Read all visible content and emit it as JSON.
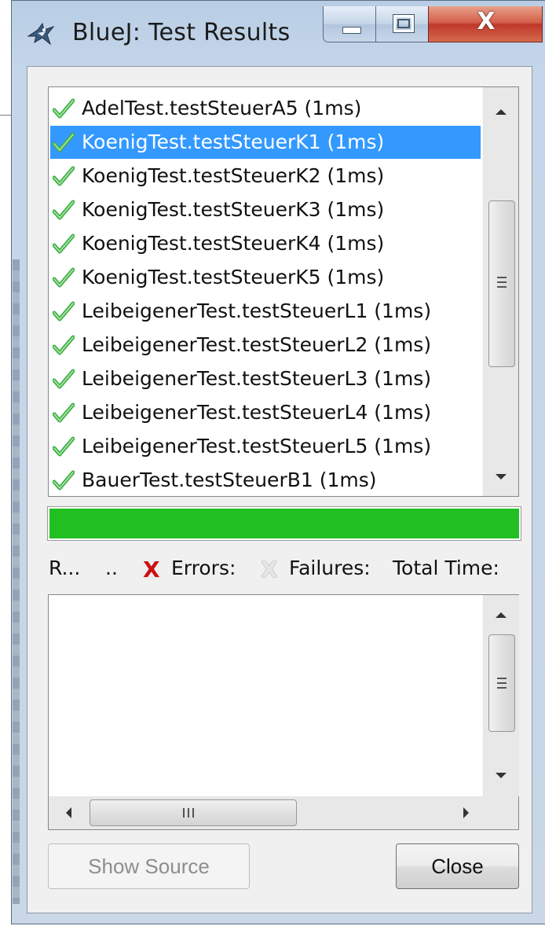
{
  "window": {
    "title": "BlueJ:  Test Results",
    "close_glyph": "X",
    "icons": {
      "app": "bluej-bird-icon",
      "minimize": "minimize-icon",
      "maximize": "maximize-icon",
      "close": "close-icon"
    }
  },
  "tests": [
    {
      "label": "AdelTest.testSteuerA5 (1ms)",
      "status": "passed",
      "selected": false
    },
    {
      "label": "KoenigTest.testSteuerK1 (1ms)",
      "status": "passed",
      "selected": true
    },
    {
      "label": "KoenigTest.testSteuerK2 (1ms)",
      "status": "passed",
      "selected": false
    },
    {
      "label": "KoenigTest.testSteuerK3 (1ms)",
      "status": "passed",
      "selected": false
    },
    {
      "label": "KoenigTest.testSteuerK4 (1ms)",
      "status": "passed",
      "selected": false
    },
    {
      "label": "KoenigTest.testSteuerK5 (1ms)",
      "status": "passed",
      "selected": false
    },
    {
      "label": "LeibeigenerTest.testSteuerL1 (1ms)",
      "status": "passed",
      "selected": false
    },
    {
      "label": "LeibeigenerTest.testSteuerL2 (1ms)",
      "status": "passed",
      "selected": false
    },
    {
      "label": "LeibeigenerTest.testSteuerL3 (1ms)",
      "status": "passed",
      "selected": false
    },
    {
      "label": "LeibeigenerTest.testSteuerL4 (1ms)",
      "status": "passed",
      "selected": false
    },
    {
      "label": "LeibeigenerTest.testSteuerL5 (1ms)",
      "status": "passed",
      "selected": false
    },
    {
      "label": "BauerTest.testSteuerB1 (1ms)",
      "status": "passed",
      "selected": false
    }
  ],
  "progress": {
    "fraction": 1.0,
    "color": "#22bf22"
  },
  "status": {
    "runs_label": "R...",
    "runs_dots": "..",
    "error_glyph": "X",
    "errors_label": "Errors:",
    "failure_glyph": "X",
    "failures_label": "Failures:",
    "total_time_label": "Total Time:"
  },
  "buttons": {
    "show_source": "Show Source",
    "close": "Close"
  },
  "colors": {
    "selection": "#3399ff",
    "pass_check": "#3fb04a",
    "error_x": "#cc1111"
  }
}
